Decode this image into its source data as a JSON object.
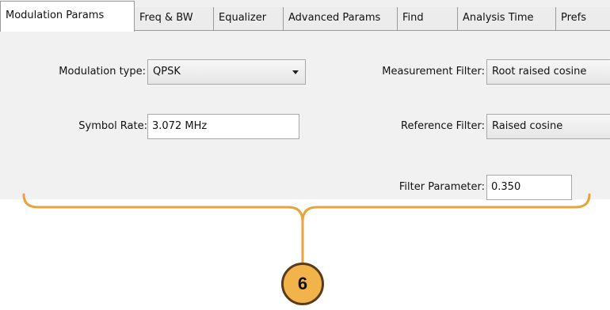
{
  "tabs": [
    {
      "label": "Modulation Params",
      "active": true
    },
    {
      "label": "Freq & BW",
      "active": false
    },
    {
      "label": "Equalizer",
      "active": false
    },
    {
      "label": "Advanced Params",
      "active": false
    },
    {
      "label": "Find",
      "active": false
    },
    {
      "label": "Analysis Time",
      "active": false
    },
    {
      "label": "Prefs",
      "active": false
    }
  ],
  "modulation_type": {
    "label": "Modulation type:",
    "value": "QPSK"
  },
  "symbol_rate": {
    "label": "Symbol Rate:",
    "value": "3.072 MHz"
  },
  "measurement_filter": {
    "label": "Measurement Filter:",
    "value": "Root raised cosine"
  },
  "reference_filter": {
    "label": "Reference Filter:",
    "value": "Raised cosine"
  },
  "filter_parameter": {
    "label": "Filter Parameter:",
    "value": "0.350"
  },
  "callout": {
    "number": "6",
    "color": "#e8a33d"
  }
}
